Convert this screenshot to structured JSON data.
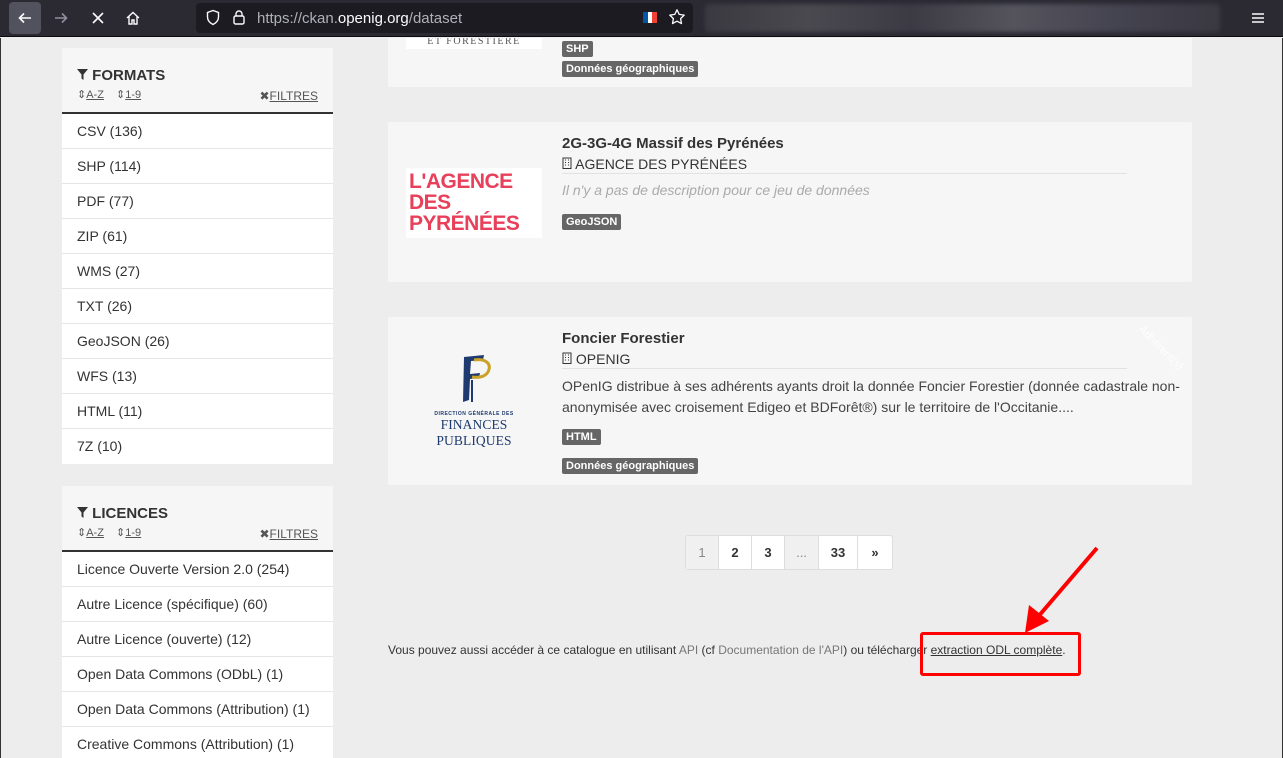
{
  "browser": {
    "url_prefix": "https://ckan.",
    "url_host": "openig.org",
    "url_path": "/dataset"
  },
  "facets": {
    "formats": {
      "title": "FORMATS",
      "sort_az": "A-Z",
      "sort_num": "1-9",
      "filter_label": "FILTRES",
      "items": [
        "CSV (136)",
        "SHP (114)",
        "PDF (77)",
        "ZIP (61)",
        "WMS (27)",
        "TXT (26)",
        "GeoJSON (26)",
        "WFS (13)",
        "HTML (11)",
        "7Z (10)"
      ]
    },
    "licences": {
      "title": "LICENCES",
      "sort_az": "A-Z",
      "sort_num": "1-9",
      "filter_label": "FILTRES",
      "items": [
        "Licence Ouverte Version 2.0 (254)",
        "Autre Licence (spécifique) (60)",
        "Autre Licence (ouverte) (12)",
        "Open Data Commons (ODbL) (1)",
        "Open Data Commons (Attribution) (1)",
        "Creative Commons (Attribution) (1)"
      ]
    }
  },
  "datasets": [
    {
      "logo_text": "ET FORESTIÈRE",
      "badges": [
        "SHP",
        "Données géographiques"
      ]
    },
    {
      "title": "2G-3G-4G Massif des Pyrénées",
      "org": "AGENCE DES PYRÉNÉES",
      "description": "Il n'y a pas de description pour ce jeu de données",
      "logo_lines": [
        "L'AGENCE",
        "DES",
        "PYRÉNÉES"
      ],
      "badges": [
        "GeoJSON"
      ]
    },
    {
      "title": "Foncier Forestier",
      "org": "OPENIG",
      "description": "OPenIG distribue à ses adhérents ayants droit la donnée Foncier Forestier (donnée cadastrale non-anonymisée avec croisement Edigeo et BDForêt®) sur le territoire de l'Occitanie....",
      "logo_small": "DIRECTION GÉNÉRALE DES",
      "logo_big": "FINANCES PUBLIQUES",
      "ribbon": "Adhérent(s)",
      "badges": [
        "HTML",
        "Données géographiques"
      ]
    }
  ],
  "pagination": [
    "1",
    "2",
    "3",
    "...",
    "33",
    "»"
  ],
  "footer": {
    "text1": "Vous pouvez aussi accéder à ce catalogue en utilisant ",
    "api": "API",
    "text2": " (cf ",
    "api_doc": "Documentation de l'API",
    "text3": ") ou télécharger ",
    "odl": "extraction ODL complète",
    "text4": "."
  },
  "colors": {
    "annotation": "#ff0000",
    "badge": "#666666",
    "agence_logo": "#e8405a"
  }
}
